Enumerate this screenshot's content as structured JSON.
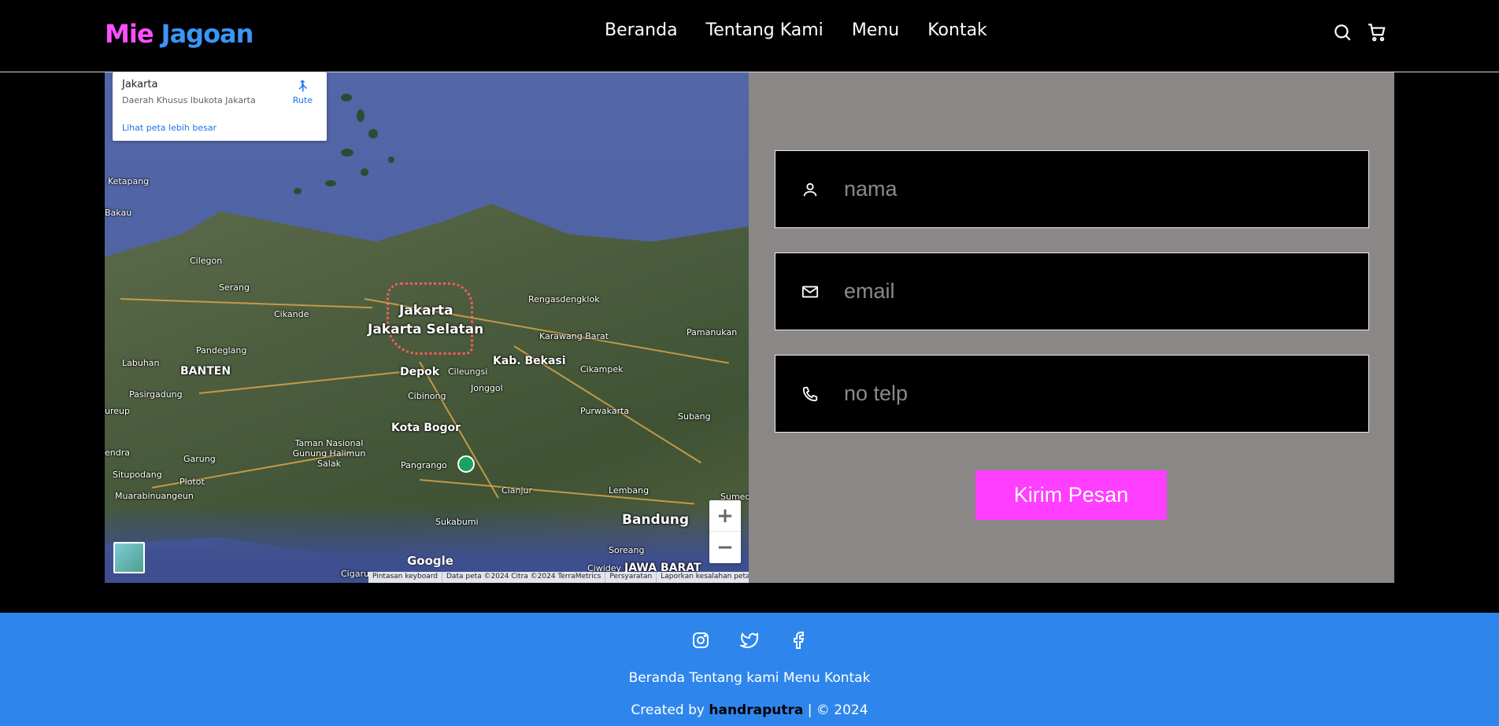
{
  "brand": {
    "part1": "Mie",
    "part2": "Jagoan",
    "color1": "#ff4fff",
    "color2": "#3b95f5"
  },
  "nav": {
    "links": [
      "Beranda",
      "Tentang Kami",
      "Menu",
      "Kontak"
    ],
    "icons": [
      "search-icon",
      "cart-icon"
    ]
  },
  "map": {
    "info_title": "Jakarta",
    "info_subtitle": "Daerah Khusus Ibukota Jakarta",
    "info_link": "Lihat peta lebih besar",
    "route_label": "Rute",
    "google": "Google",
    "attribution": [
      "Pintasan keyboard",
      "Data peta ©2024 Citra ©2024 TerraMetrics",
      "Persyaratan",
      "Laporkan kesalahan peta"
    ],
    "labels": {
      "ketapang": "Ketapang",
      "bakau": "Bakau",
      "cilegon": "Cilegon",
      "serang": "Serang",
      "cikande": "Cikande",
      "jakarta": "Jakarta",
      "jakarta_selatan": "Jakarta Selatan",
      "rengasdengklok": "Rengasdengklok",
      "karawang": "Karawang Barat",
      "pamanukan": "Pamanukan",
      "pandeglang": "Pandeglang",
      "labuhan": "Labuhan",
      "banten": "BANTEN",
      "depok": "Depok",
      "cileungsi": "Cileungsi",
      "kab_bekasi": "Kab. Bekasi",
      "cikampek": "Cikampek",
      "pasirgadung": "Pasirgadung",
      "cibinong": "Cibinong",
      "jonggol": "Jonggol",
      "purwakarta": "Purwakarta",
      "subang": "Subang",
      "kota_bogor": "Kota Bogor",
      "garung": "Garung",
      "taman": "Taman Nasional Gunung Halimun Salak",
      "plotot": "Plotot",
      "pangrango": "Pangrango",
      "cianjur": "Cianjur",
      "lembang": "Lembang",
      "muarabinuangeun": "Muarabinuangeun",
      "situpodang": "Situpodang",
      "sukabumi": "Sukabumi",
      "bandung": "Bandung",
      "soreang": "Soreang",
      "cigaru": "Cigaru",
      "ciwidey": "Ciwidey",
      "jawa_barat": "JAWA BARAT",
      "sumedang": "Sumed",
      "ureup": "ureup",
      "endra": "endra"
    }
  },
  "form": {
    "name_placeholder": "nama",
    "email_placeholder": "email",
    "phone_placeholder": "no telp",
    "submit_label": "Kirim Pesan",
    "bg_color": "#8b8787",
    "button_color": "#ff3eff"
  },
  "footer": {
    "social_icons": [
      "instagram-icon",
      "twitter-icon",
      "facebook-icon"
    ],
    "links": [
      "Beranda",
      "Tentang kami",
      "Menu",
      "Kontak"
    ],
    "credit_prefix": "Created by",
    "credit_author": "handraputra",
    "credit_suffix": "| © 2024",
    "bg_color": "#2e86ed"
  }
}
